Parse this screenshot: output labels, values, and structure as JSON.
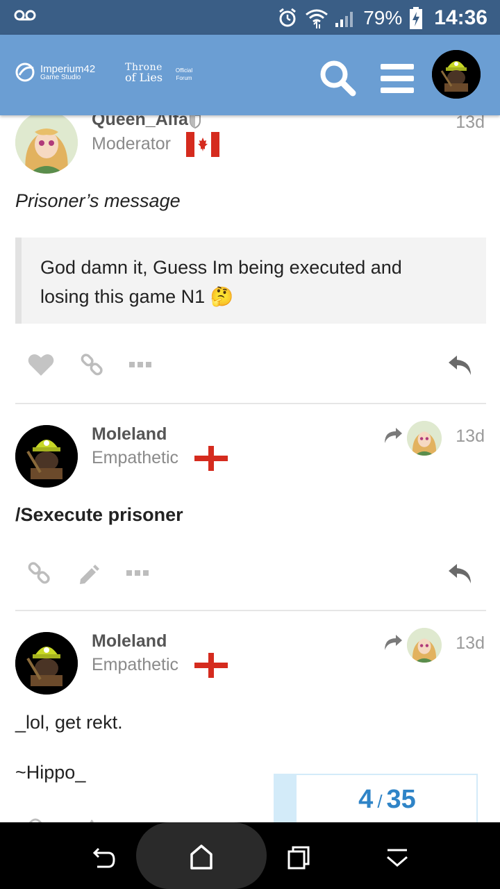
{
  "status_bar": {
    "icons": [
      "voicemail-icon",
      "alarm-icon",
      "wifi-icon",
      "signal-icon",
      "battery-charging-icon"
    ],
    "battery": "79%",
    "time": "14:36"
  },
  "header": {
    "brand_name": "Imperium42",
    "brand_sub": "Game Studio",
    "game_line1": "Throne",
    "game_line2": "of Lies",
    "official_line1": "Official",
    "official_line2": "Forum",
    "icons": [
      "search-icon",
      "hamburger-menu-icon",
      "user-avatar"
    ]
  },
  "posts": [
    {
      "username": "Queen_Alfa",
      "title": "Moderator",
      "age": "13d",
      "flag": "canada",
      "body": "Prisoner’s message",
      "quote_line1": "God damn it, Guess Im being executed and",
      "quote_line2": "losing this game N1 🤔",
      "actions": [
        "like-icon",
        "link-icon",
        "more-icon",
        "reply-icon"
      ]
    },
    {
      "username": "Moleland",
      "title": "Empathetic",
      "age": "13d",
      "flag": "england",
      "body": "/Sexecute prisoner",
      "actions": [
        "link-icon",
        "edit-icon",
        "more-icon",
        "reply-icon"
      ]
    },
    {
      "username": "Moleland",
      "title": "Empathetic",
      "age": "13d",
      "flag": "england",
      "body_line1": "_lol, get rekt.",
      "body_line2": "~Hippo_"
    }
  ],
  "timeline": {
    "current": "4",
    "separator": "/",
    "total": "35"
  },
  "colors": {
    "status_bar": "#3a5e86",
    "header": "#6b9ed3",
    "accent": "#2f84c7",
    "timeline_rail": "#d3ebf9"
  },
  "nav_bar": {
    "icons": [
      "back-icon",
      "home-icon",
      "recents-icon",
      "notifications-icon"
    ]
  }
}
